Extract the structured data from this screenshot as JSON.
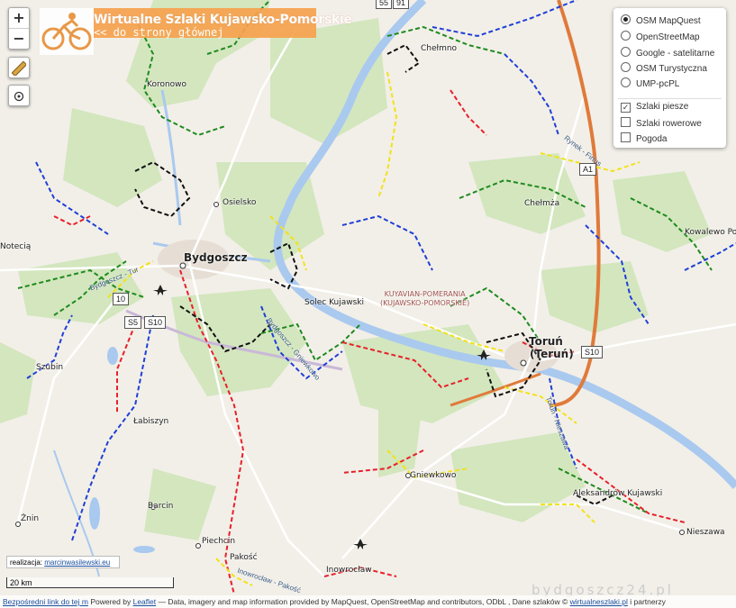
{
  "title": {
    "heading": "Wirtualne Szlaki Kujawsko-Pomorskie",
    "back_link": "<< do strony głównej"
  },
  "zoom": {
    "in": "+",
    "out": "−"
  },
  "tools": {
    "measure_icon": "ruler-icon",
    "locate_icon": "locate-icon"
  },
  "layers": {
    "base": [
      {
        "label": "OSM MapQuest",
        "selected": true
      },
      {
        "label": "OpenStreetMap",
        "selected": false
      },
      {
        "label": "Google - satelitarne",
        "selected": false
      },
      {
        "label": "OSM Turystyczna",
        "selected": false
      },
      {
        "label": "UMP-pcPL",
        "selected": false
      }
    ],
    "overlays": [
      {
        "label": "Szlaki piesze",
        "checked": true
      },
      {
        "label": "Szlaki rowerowe",
        "checked": false
      },
      {
        "label": "Pogoda",
        "checked": false
      }
    ]
  },
  "places": {
    "bydgoszcz": "Bydgoszcz",
    "torun": "Toruń",
    "torun_alt": "(Teruń)",
    "koronowo": "Koronowo",
    "osielsko": "Osielsko",
    "solec": "Solec Kujawski",
    "notecia": "Notecią",
    "szubin": "Szubin",
    "labiszyn": "Łabiszyn",
    "barcin": "Barcin",
    "znin": "Żnin",
    "piechcin": "Piechcin",
    "pakosc": "Pakość",
    "inowroclaw": "Inowrocław",
    "gniewkowo": "Gniewkowo",
    "aleksandrow": "Aleksandrów Kujawski",
    "nieszawa": "Nieszawa",
    "chelmza": "Chełmża",
    "chelmno": "Chełmno",
    "kowalewo": "Kowalewo Po",
    "region_line1": "KUYAVIAN-POMERANIA",
    "region_line2": "(KUJAWSKO-POMORSKIE)"
  },
  "roads": {
    "bydgoszcz_tur": "Bydgoszcz - Tur",
    "bydgoszcz_gniewkowo": "Bydgoszcz - Gniewkowo",
    "torun_nieszawa": "Toruń - Nieszawa",
    "rynek_firtus": "Rynek - Firtus",
    "inowroclaw_pakosc": "Inowrocław - Pakość"
  },
  "shields": {
    "a1": "A1",
    "s10_east": "S10",
    "s5": "S5",
    "s10_west": "S10",
    "r10": "10",
    "top1": "55",
    "top2": "91"
  },
  "footer": {
    "realizacja_label": "realizacja:",
    "realizacja_link": "marcinwasilewski.eu",
    "scale": "20 km",
    "watermark": "bydgoszcz24.pl",
    "direct_link": "Bezpośredni link do tej m",
    "powered": " Powered by ",
    "leaflet": "Leaflet",
    "data_text": " — Data, imagery and map information provided by MapQuest, OpenStreetMap and contributors, ODbL , Dane szlaków © ",
    "trails_link": "wirtualneszlaki.pl",
    "partners": " i partnerzy"
  },
  "colors": {
    "trail_red": "#e8202a",
    "trail_blue": "#1f3fd8",
    "trail_green": "#1e8a1e",
    "trail_yellow": "#f2e21a",
    "trail_black": "#111111",
    "river": "#a9c9ef",
    "forest": "#cfe3b8",
    "highway": "#e07a3a",
    "title_bg": "#f7a24e"
  }
}
